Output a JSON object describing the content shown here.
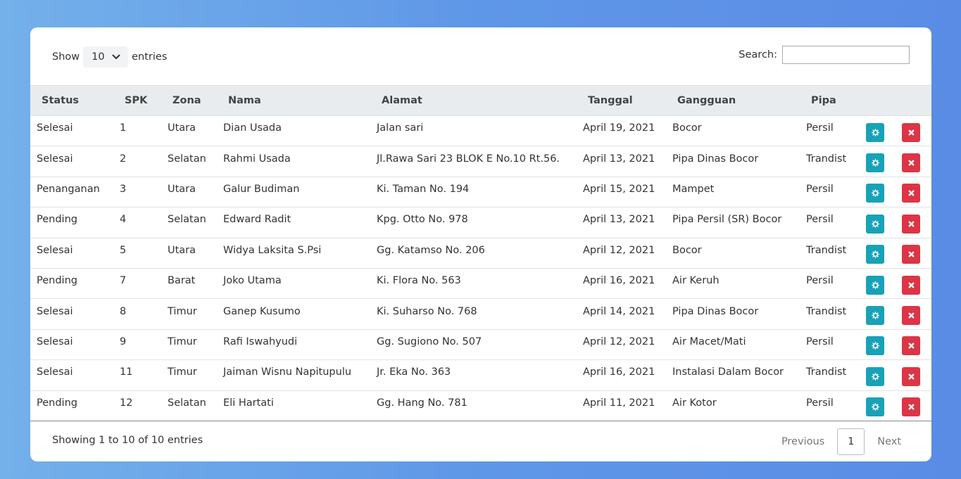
{
  "length_control": {
    "show_label": "Show",
    "value": "10",
    "entries_label": "entries"
  },
  "search": {
    "label": "Search:",
    "value": "",
    "placeholder": ""
  },
  "table": {
    "columns": [
      "Status",
      "SPK",
      "Zona",
      "Nama",
      "Alamat",
      "Tanggal",
      "Gangguan",
      "Pipa"
    ],
    "rows": [
      [
        "Selesai",
        "1",
        "Utara",
        "Dian Usada",
        "Jalan sari",
        "April 19, 2021",
        "Bocor",
        "Persil"
      ],
      [
        "Selesai",
        "2",
        "Selatan",
        "Rahmi Usada",
        "Jl.Rawa Sari 23 BLOK E No.10 Rt.56.",
        "April 13, 2021",
        "Pipa Dinas Bocor",
        "Trandist"
      ],
      [
        "Penanganan",
        "3",
        "Utara",
        "Galur Budiman",
        "Ki. Taman No. 194",
        "April 15, 2021",
        "Mampet",
        "Persil"
      ],
      [
        "Pending",
        "4",
        "Selatan",
        "Edward Radit",
        "Kpg. Otto No. 978",
        "April 13, 2021",
        "Pipa Persil (SR) Bocor",
        "Persil"
      ],
      [
        "Selesai",
        "5",
        "Utara",
        "Widya Laksita S.Psi",
        "Gg. Katamso No. 206",
        "April 12, 2021",
        "Bocor",
        "Trandist"
      ],
      [
        "Pending",
        "7",
        "Barat",
        "Joko Utama",
        "Ki. Flora No. 563",
        "April 16, 2021",
        "Air Keruh",
        "Persil"
      ],
      [
        "Selesai",
        "8",
        "Timur",
        "Ganep Kusumo",
        "Ki. Suharso No. 768",
        "April 14, 2021",
        "Pipa Dinas Bocor",
        "Trandist"
      ],
      [
        "Selesai",
        "9",
        "Timur",
        "Rafi Iswahyudi",
        "Gg. Sugiono No. 507",
        "April 12, 2021",
        "Air Macet/Mati",
        "Persil"
      ],
      [
        "Selesai",
        "11",
        "Timur",
        "Jaiman Wisnu Napitupulu",
        "Jr. Eka No. 363",
        "April 16, 2021",
        "Instalasi Dalam Bocor",
        "Trandist"
      ],
      [
        "Pending",
        "12",
        "Selatan",
        "Eli Hartati",
        "Gg. Hang No. 781",
        "April 11, 2021",
        "Air Kotor",
        "Persil"
      ]
    ],
    "actions": {
      "edit_icon": "gear-icon",
      "delete_icon": "close-icon"
    }
  },
  "footer": {
    "info": "Showing 1 to 10 of 10 entries",
    "previous": "Previous",
    "current_page": "1",
    "next": "Next"
  },
  "colors": {
    "edit_button": "#17a2b8",
    "delete_button": "#dc3545",
    "header_bg": "#e9ecef"
  }
}
